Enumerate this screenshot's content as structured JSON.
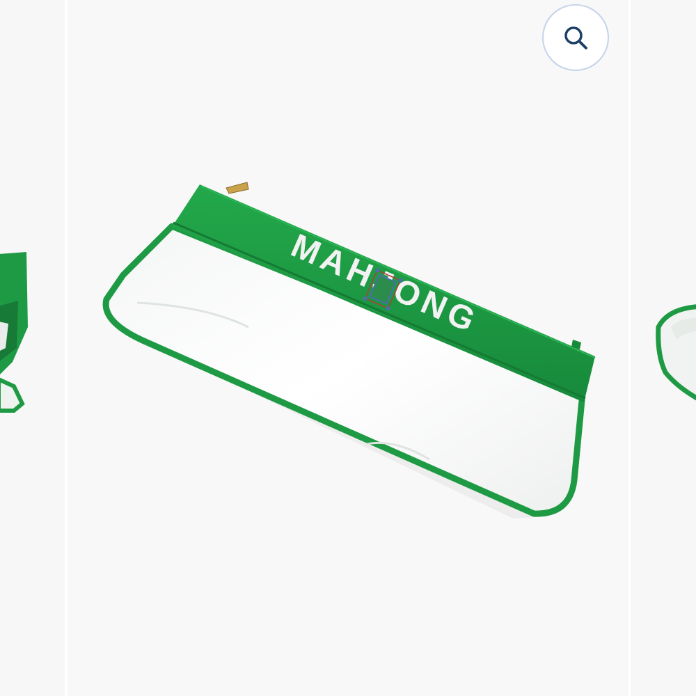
{
  "gallery": {
    "current_image": {
      "embroidered_text": "MAHJONG",
      "product_color": "#1f9a44"
    },
    "zoom_button": {
      "icon": "search-icon",
      "aria_label": "Zoom"
    }
  },
  "colors": {
    "slide_background": "#f8f8f8",
    "trim_green": "#1f9a44",
    "zoom_icon": "#1c3f66",
    "zoom_border": "#c4d3ea"
  }
}
